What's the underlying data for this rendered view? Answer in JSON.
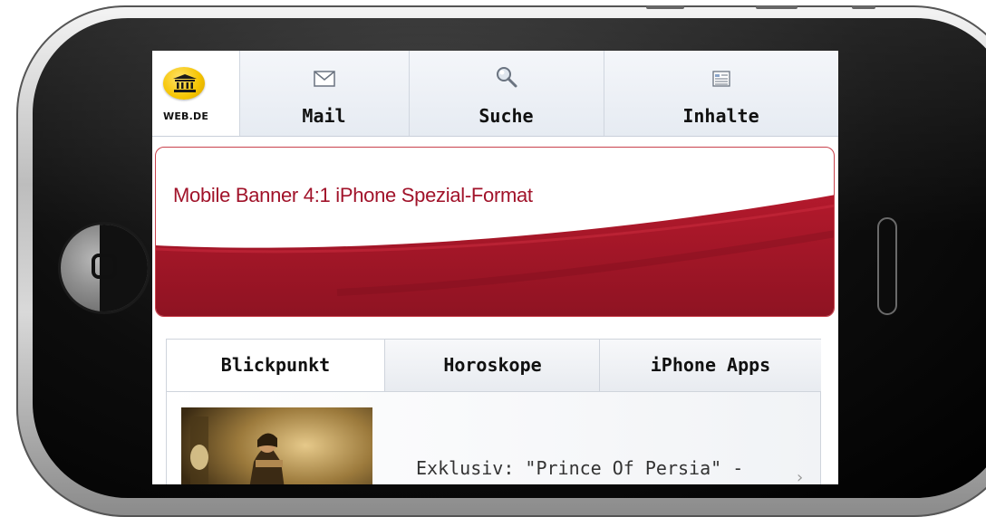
{
  "nav": {
    "logo_text": "WEB.DE",
    "tabs": [
      {
        "label": "Mail",
        "icon": "envelope-icon"
      },
      {
        "label": "Suche",
        "icon": "magnifier-icon"
      },
      {
        "label": "Inhalte",
        "icon": "content-list-icon"
      }
    ]
  },
  "banner": {
    "title": "Mobile Banner 4:1 iPhone Spezial-Format",
    "colors": {
      "accent": "#a1132a",
      "band": "#9b1526"
    }
  },
  "content": {
    "tabs": [
      {
        "label": "Blickpunkt",
        "active": true
      },
      {
        "label": "Horoskope",
        "active": false
      },
      {
        "label": "iPhone Apps",
        "active": false
      }
    ],
    "article": {
      "headline": "Exklusiv: \"Prince Of Persia\" -",
      "chevron": "›"
    }
  }
}
